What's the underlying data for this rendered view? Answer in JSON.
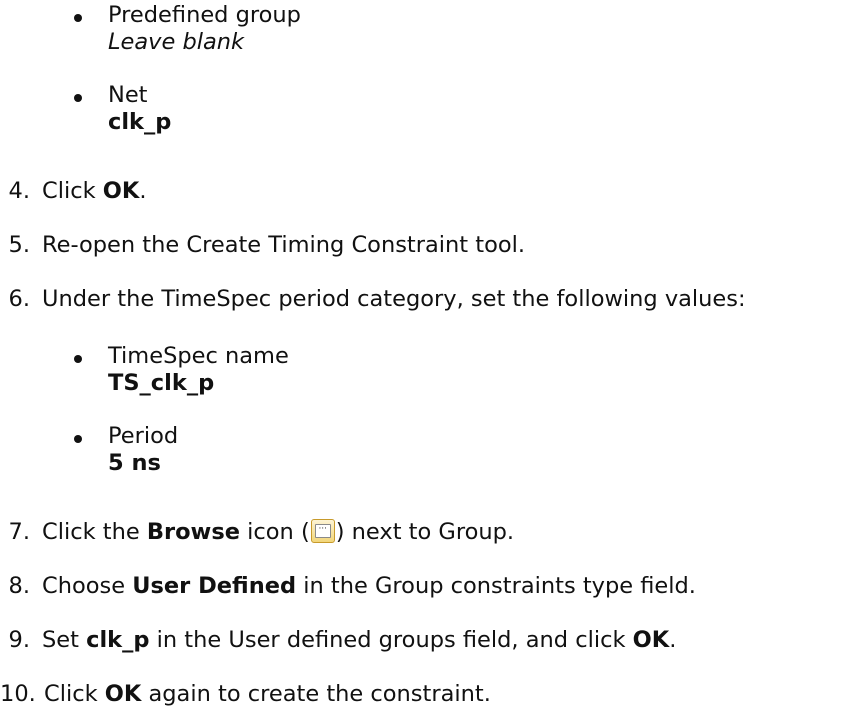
{
  "bullets_top": [
    {
      "label": "Predefined group",
      "value": "Leave blank",
      "style": "italic"
    },
    {
      "label": "Net",
      "value": "clk_p",
      "style": "bold"
    }
  ],
  "step4": {
    "num": "4.",
    "pre": "Click ",
    "bold": "OK",
    "post": "."
  },
  "step5": {
    "num": "5.",
    "text": "Re-open the Create Timing Constraint tool."
  },
  "step6": {
    "num": "6.",
    "text": "Under the TimeSpec period category, set the following values:"
  },
  "bullets_mid": [
    {
      "label": "TimeSpec name",
      "value": "TS_clk_p",
      "style": "bold"
    },
    {
      "label": "Period",
      "value": "5 ns",
      "style": "bold"
    }
  ],
  "step7": {
    "num": "7.",
    "pre": "Click the ",
    "bold": "Browse",
    "mid": " icon (",
    "post": ") next to Group.",
    "icon": "browse-icon"
  },
  "step8": {
    "num": "8.",
    "pre": "Choose ",
    "bold": "User Defined",
    "post": " in the Group constraints type field."
  },
  "step9": {
    "num": "9.",
    "pre": "Set ",
    "bold": "clk_p",
    "mid": " in the User defined groups field, and click ",
    "bold2": "OK",
    "post": "."
  },
  "step10": {
    "num": "10.",
    "pre": "Click ",
    "bold": "OK",
    "post": " again to create the constraint."
  }
}
